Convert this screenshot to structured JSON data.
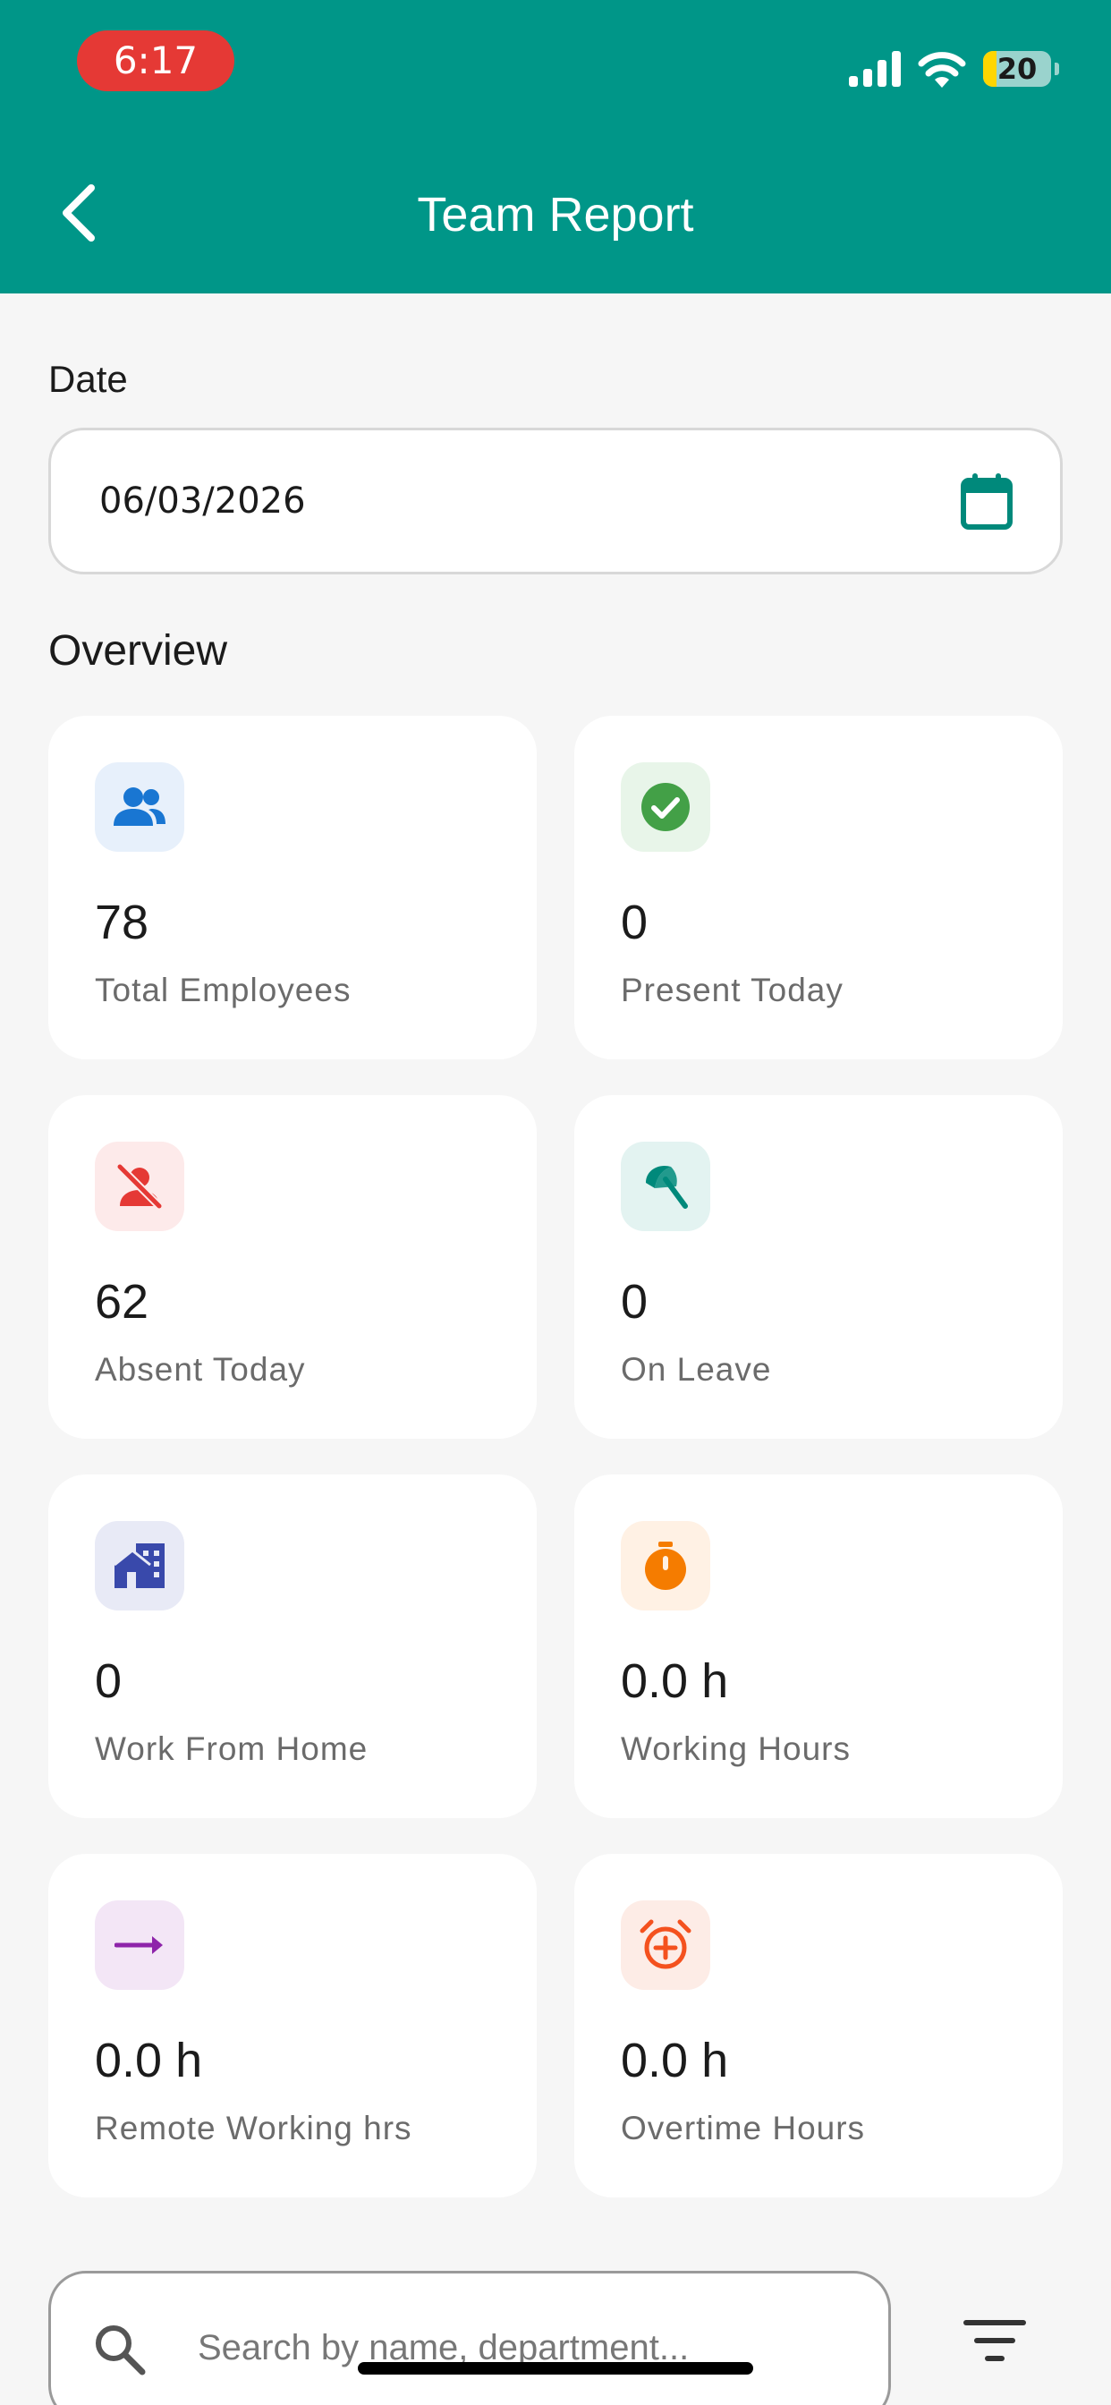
{
  "status_bar": {
    "time": "6:17",
    "battery_level": "20",
    "battery_fraction": 0.2
  },
  "header": {
    "title": "Team Report"
  },
  "date_filter": {
    "label": "Date",
    "value": "06/03/2026"
  },
  "overview": {
    "title": "Overview",
    "cards": [
      {
        "value": "78",
        "label": "Total Employees",
        "icon": "people-icon",
        "icon_color": "#1976d2",
        "icon_bg": "#e7f0fb"
      },
      {
        "value": "0",
        "label": "Present Today",
        "icon": "check-circle-icon",
        "icon_color": "#43a047",
        "icon_bg": "#e8f5e9"
      },
      {
        "value": "62",
        "label": "Absent Today",
        "icon": "person-off-icon",
        "icon_color": "#e53935",
        "icon_bg": "#fdeaea"
      },
      {
        "value": "0",
        "label": "On Leave",
        "icon": "beach-umbrella-icon",
        "icon_color": "#00897b",
        "icon_bg": "#e3f3f1"
      },
      {
        "value": "0",
        "label": "Work From Home",
        "icon": "home-work-icon",
        "icon_color": "#3949ab",
        "icon_bg": "#e8eaf6"
      },
      {
        "value": "0.0 h",
        "label": "Working Hours",
        "icon": "timer-icon",
        "icon_color": "#f57c00",
        "icon_bg": "#fff1e4"
      },
      {
        "value": "0.0 h",
        "label": "Remote Working hrs",
        "icon": "arrow-right-icon",
        "icon_color": "#8e24aa",
        "icon_bg": "#f3e6f6"
      },
      {
        "value": "0.0 h",
        "label": "Overtime Hours",
        "icon": "alarm-add-icon",
        "icon_color": "#f4511e",
        "icon_bg": "#fdece6"
      }
    ]
  },
  "search": {
    "placeholder": "Search by name, department..."
  },
  "colors": {
    "primary": "#009688",
    "status_pill": "#e53935"
  }
}
